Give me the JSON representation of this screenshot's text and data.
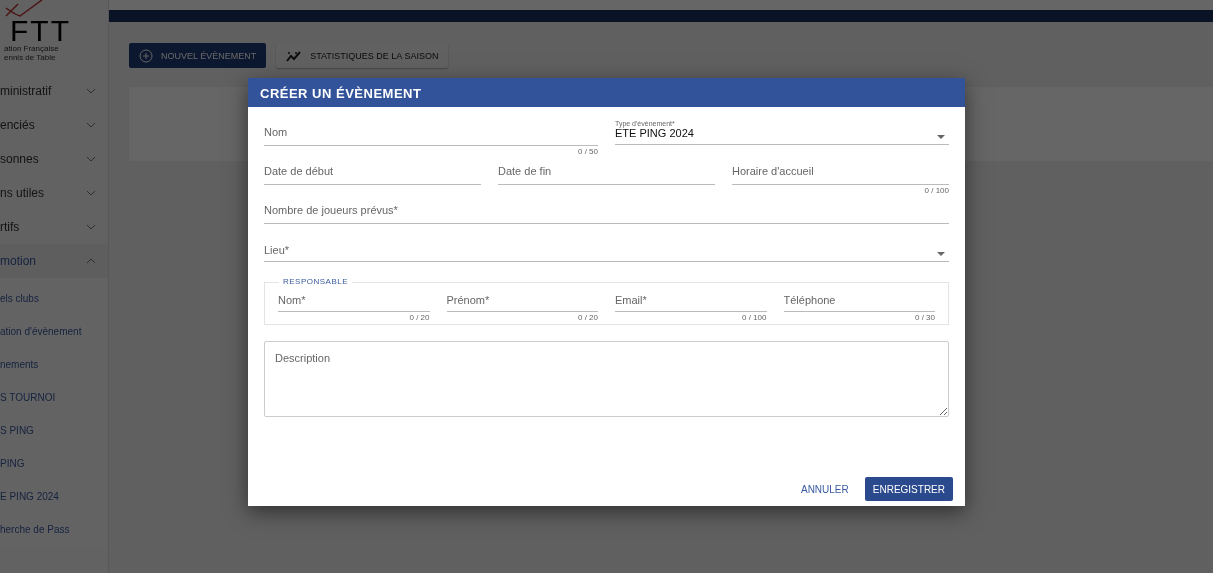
{
  "sidebar": {
    "logo": {
      "mark": "FTT",
      "lines": [
        "ation Française",
        "ennis de Table"
      ]
    },
    "items": [
      {
        "label": "ministratif",
        "expanded": false
      },
      {
        "label": "enciés",
        "expanded": false
      },
      {
        "label": "sonnes",
        "expanded": false
      },
      {
        "label": "ns utiles",
        "expanded": false
      },
      {
        "label": "rtifs",
        "expanded": false
      },
      {
        "label": "motion",
        "expanded": true,
        "children": [
          {
            "label": "els clubs"
          },
          {
            "label": "ation d'évènement"
          },
          {
            "label": "nements"
          },
          {
            "label": "S TOURNOI"
          },
          {
            "label": "S PING"
          },
          {
            "label": "PING"
          },
          {
            "label": "E PING 2024"
          },
          {
            "label": "herche de Pass"
          }
        ]
      }
    ]
  },
  "toolbar": [
    {
      "label": "NOUVEL ÉVÈNEMENT",
      "kind": "primary"
    },
    {
      "label": "STATISTIQUES DE LA SAISON",
      "kind": "secondary"
    }
  ],
  "dialog": {
    "title": "CRÉER UN ÉVÈNEMENT",
    "rows": [
      [
        {
          "kind": "text",
          "placeholder": "Nom",
          "counter": "0 / 50"
        },
        {
          "kind": "select",
          "label": "Type d'évènement*",
          "value": "ETE PING 2024"
        }
      ],
      [
        {
          "kind": "text",
          "placeholder": "Date de début"
        },
        {
          "kind": "text",
          "placeholder": "Date de fin"
        },
        {
          "kind": "text",
          "placeholder": "Horaire d'accueil",
          "counter": "0 / 100"
        }
      ],
      [
        {
          "kind": "text",
          "placeholder": "Nombre de joueurs prévus*"
        }
      ],
      [
        {
          "kind": "select",
          "placeholder": "Lieu*"
        }
      ]
    ],
    "responsable": {
      "legend": "RESPONSABLE",
      "fields": [
        {
          "placeholder": "Nom*",
          "counter": "0 / 20"
        },
        {
          "placeholder": "Prénom*",
          "counter": "0 / 20"
        },
        {
          "placeholder": "Email*",
          "counter": "0 / 100"
        },
        {
          "placeholder": "Téléphone",
          "counter": "0 / 30"
        }
      ]
    },
    "description": {
      "placeholder": "Description"
    },
    "buttons": [
      {
        "label": "ANNULER",
        "kind": "text"
      },
      {
        "label": "ENREGISTRER",
        "kind": "primary"
      }
    ]
  }
}
